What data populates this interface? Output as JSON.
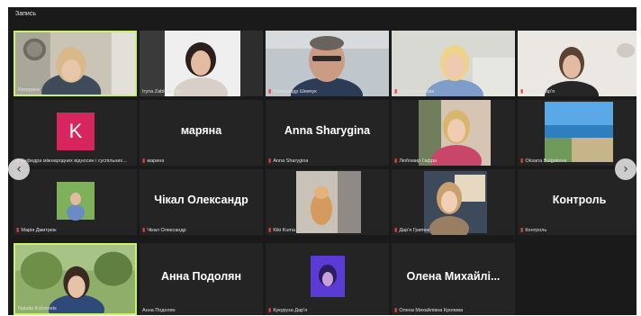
{
  "window": {
    "title": "Запись"
  },
  "nav": {
    "prev_icon": "chevron-left-icon",
    "next_icon": "chevron-right-icon",
    "prev_glyph": "‹",
    "next_glyph": "›"
  },
  "colors": {
    "active_border": "#c9f26b",
    "tile_bg": "#242424",
    "frame_bg": "#1a1a1a",
    "mic_muted": "#e8443a",
    "avatar_k": "#d6265d"
  },
  "participants": [
    {
      "name": "Катерина",
      "muted": false,
      "type": "video",
      "active": true
    },
    {
      "name": "Iryna Zablotskaya",
      "muted": false,
      "type": "video"
    },
    {
      "name": "Олександр Шевчук",
      "muted": true,
      "type": "video"
    },
    {
      "name": "Юлія Сосонова",
      "muted": true,
      "type": "video"
    },
    {
      "name": "Мартін Дар'я",
      "muted": true,
      "type": "video"
    },
    {
      "name": "Кафедра міжнародних відносин і суспільних...",
      "muted": true,
      "type": "avatar",
      "avatar_letter": "K"
    },
    {
      "name": "марина",
      "muted": true,
      "type": "text",
      "display": "маряна"
    },
    {
      "name": "Anna Sharygina",
      "muted": true,
      "type": "text",
      "display": "Anna Sharygina"
    },
    {
      "name": "Любомир Гафра",
      "muted": true,
      "type": "video"
    },
    {
      "name": "Oksana Bulgakova",
      "muted": true,
      "type": "video"
    },
    {
      "name": "Марія Дмитрюк",
      "muted": true,
      "type": "video"
    },
    {
      "name": "Чікал Олександр",
      "muted": true,
      "type": "text",
      "display": "Чікал Олександр"
    },
    {
      "name": "Kiki Kuma",
      "muted": true,
      "type": "video"
    },
    {
      "name": "Дар'я Грипюк",
      "muted": true,
      "type": "video"
    },
    {
      "name": "Контроль",
      "muted": true,
      "type": "text",
      "display": "Контроль"
    },
    {
      "name": "Natalia Kolomiets",
      "muted": false,
      "type": "video",
      "active": true
    },
    {
      "name": "Анна Подолян",
      "muted": false,
      "type": "text",
      "display": "Анна Подолян"
    },
    {
      "name": "Кукуруза Дар'я",
      "muted": true,
      "type": "video"
    },
    {
      "name": "Олена Михайлівна Кропива",
      "muted": true,
      "type": "text",
      "display": "Олена  Михайлі..."
    }
  ]
}
